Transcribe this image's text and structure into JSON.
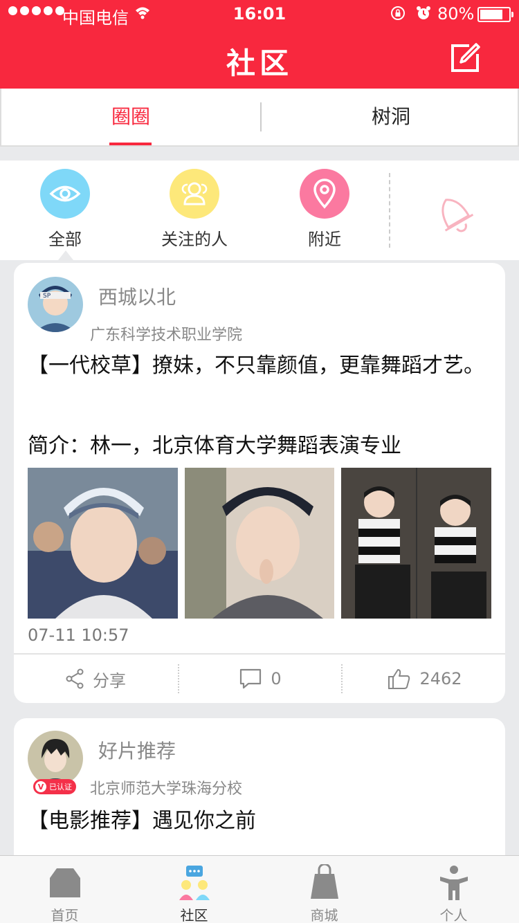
{
  "status_bar": {
    "carrier": "中国电信",
    "time": "16:01",
    "battery": "80%"
  },
  "header": {
    "title": "社区",
    "edit_icon": "edit-icon"
  },
  "tabs": [
    {
      "label": "圈圈",
      "active": true
    },
    {
      "label": "树洞",
      "active": false
    }
  ],
  "filters": [
    {
      "label": "全部",
      "icon": "eye-icon",
      "color": "#7fd8f8"
    },
    {
      "label": "关注的人",
      "icon": "people-icon",
      "color": "#fde87a"
    },
    {
      "label": "附近",
      "icon": "location-pin-icon",
      "color": "#fb79a0"
    }
  ],
  "posts": [
    {
      "username": "西城以北",
      "school": "广东科学技术职业学院",
      "text_line1": "【一代校草】撩妹，不只靠颜值，更靠舞蹈才艺。",
      "text_line2": "简介：林一，北京体育大学舞蹈表演专业",
      "timestamp": "07-11 10:57",
      "share_label": "分享",
      "comments": "0",
      "likes": "2462"
    },
    {
      "username": "好片推荐",
      "school": "北京师范大学珠海分校",
      "verified_label": "已认证",
      "text_line1": "【电影推荐】遇见你之前"
    }
  ],
  "bottom_nav": [
    {
      "label": "首页",
      "icon": "home-icon",
      "active": false
    },
    {
      "label": "社区",
      "icon": "community-icon",
      "active": true
    },
    {
      "label": "商城",
      "icon": "shopping-bag-icon",
      "active": false
    },
    {
      "label": "个人",
      "icon": "person-icon",
      "active": false
    }
  ],
  "colors": {
    "brand_red": "#f8283e",
    "background": "#e9eaec"
  }
}
